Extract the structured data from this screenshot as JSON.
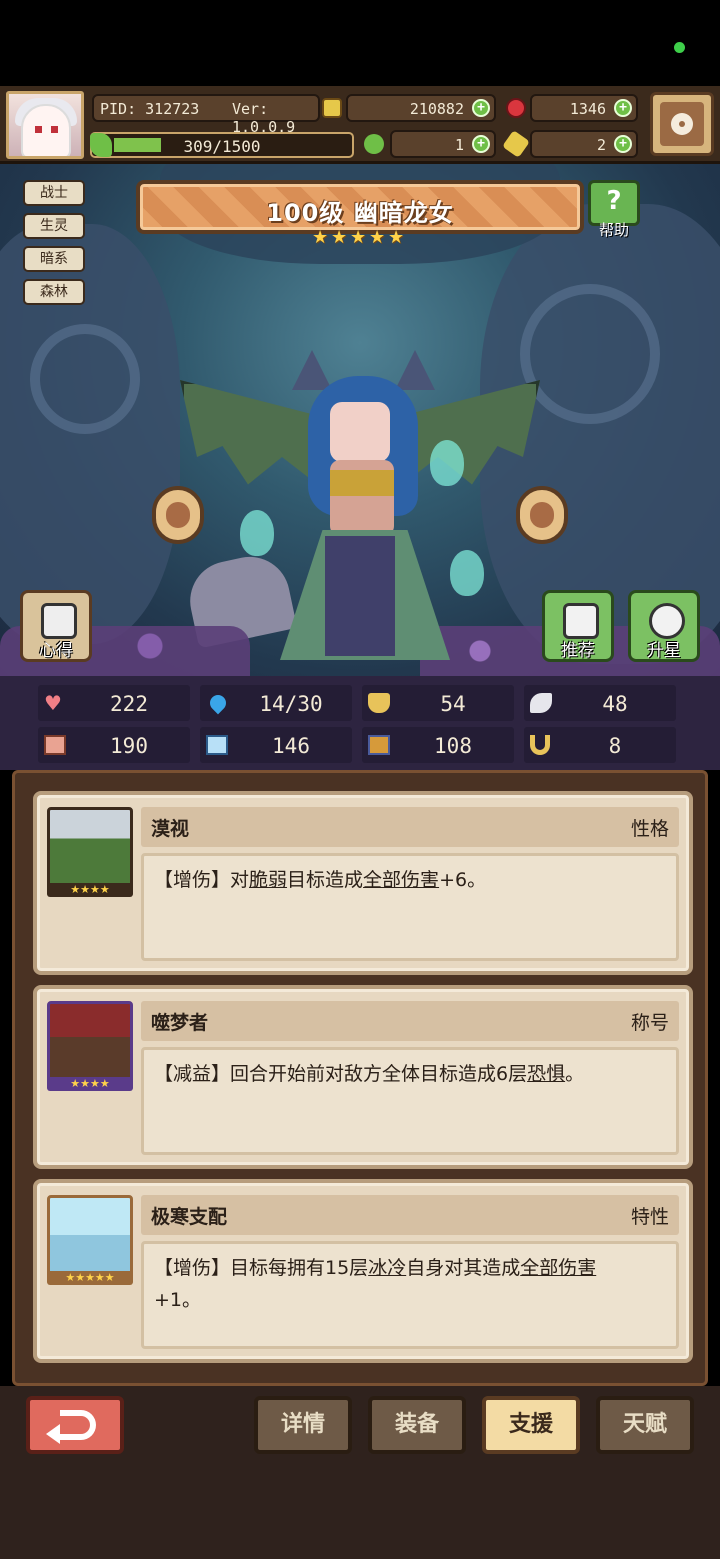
{
  "player": {
    "pid": "PID: 312723",
    "version": "Ver: 1.0.0.9",
    "exp": "309/1500",
    "exp_progress": 0.206
  },
  "resources": {
    "gold": "210882",
    "gems": "1346",
    "clover": "1",
    "bottle": "2"
  },
  "colors": {
    "status_dot": "#3ecf4a",
    "plus": "#6fbf47"
  },
  "hero": {
    "name": "100级 幽暗龙女",
    "stars": 5,
    "tags": [
      "战士",
      "生灵",
      "暗系",
      "森林"
    ],
    "help_label": "帮助",
    "left_button": "心得",
    "right_buttons": [
      "推荐",
      "升星"
    ]
  },
  "stats": [
    {
      "icon": "heart-icon",
      "value": "222"
    },
    {
      "icon": "water-drop-icon",
      "value": "14/30"
    },
    {
      "icon": "shield-icon",
      "value": "54"
    },
    {
      "icon": "wing-icon",
      "value": "48"
    },
    {
      "icon": "fist-icon",
      "value": "190"
    },
    {
      "icon": "book-icon",
      "value": "146"
    },
    {
      "icon": "boot-icon",
      "value": "108"
    },
    {
      "icon": "horseshoe-icon",
      "value": "8"
    }
  ],
  "cards": [
    {
      "title": "漠视",
      "type": "性格",
      "stars": "★★★★",
      "body_pre": "【增伤】对",
      "kw1": "脆弱",
      "mid": "目标造成",
      "kw2": "全部伤害",
      "body_post": "+6。"
    },
    {
      "title": "噬梦者",
      "type": "称号",
      "stars": "★★★★",
      "body_pre": "【减益】回合开始前对敌方全体目标造成6层",
      "kw1": "恐惧",
      "mid": "。",
      "kw2": "",
      "body_post": ""
    },
    {
      "title": "极寒支配",
      "type": "特性",
      "stars": "★★★★★",
      "body_pre": "【增伤】目标每拥有15层",
      "kw1": "冰冷",
      "mid": "自身对其造成",
      "kw2": "全部伤害",
      "body_post": "+1。"
    }
  ],
  "footer": {
    "tabs": [
      "详情",
      "装备",
      "支援",
      "天赋"
    ],
    "active_tab": "支援"
  }
}
